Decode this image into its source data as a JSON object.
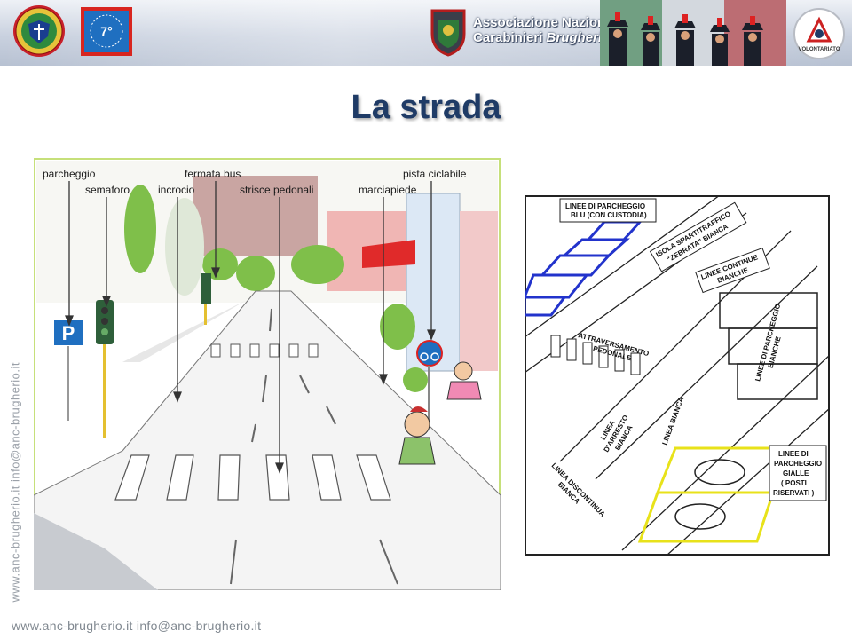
{
  "header": {
    "association_line1": "Associazione Nazionale",
    "association_line2_a": "Carabinieri",
    "association_line2_b": "Brugherio",
    "badge_number": "7°",
    "volontariato": "VOLONTARIATO"
  },
  "slide": {
    "title": "La strada"
  },
  "left_illustration": {
    "labels": {
      "parcheggio": "parcheggio",
      "semaforo": "semaforo",
      "incrocio": "incrocio",
      "fermata_bus": "fermata bus",
      "strisce_pedonali": "strisce pedonali",
      "marciapiede": "marciapiede",
      "pista_ciclabile": "pista ciclabile"
    },
    "parking_sign": "P"
  },
  "right_illustration": {
    "labels": {
      "blu_1": "LINEE DI PARCHEGGIO",
      "blu_2": "BLU (CON CUSTODIA)",
      "isola_1": "ISOLA SPARTITRAFFICO",
      "isola_2": "\"ZEBRATA\" BIANCA",
      "continue_1": "LINEE CONTINUE",
      "continue_2": "BIANCHE",
      "attr_1": "ATTRAVERSAMENTO",
      "attr_2": "PEDONALE",
      "bianche_1": "LINEE DI PARCHEGGIO",
      "bianche_2": "BIANCHE",
      "arresto_1": "LINEA",
      "arresto_2": "D'ARRESTO",
      "arresto_3": "BIANCA",
      "linea_bianca": "LINEA BIANCA",
      "disc_1": "LINEA DISCONTINUA",
      "disc_2": "BIANCA",
      "gialle_1": "LINEE DI",
      "gialle_2": "PARCHEGGIO",
      "gialle_3": "GIALLE",
      "gialle_4": "( POSTI",
      "gialle_5": "RISERVATI )"
    }
  },
  "contacts": {
    "vertical": "www.anc-brugherio.it   info@anc-brugherio.it",
    "footer": "www.anc-brugherio.it   info@anc-brugherio.it"
  },
  "colors": {
    "title": "#1f3b66",
    "left_frame": "#c6e07a",
    "blue_parking": "#2233cc",
    "yellow_parking": "#e8e21a"
  }
}
